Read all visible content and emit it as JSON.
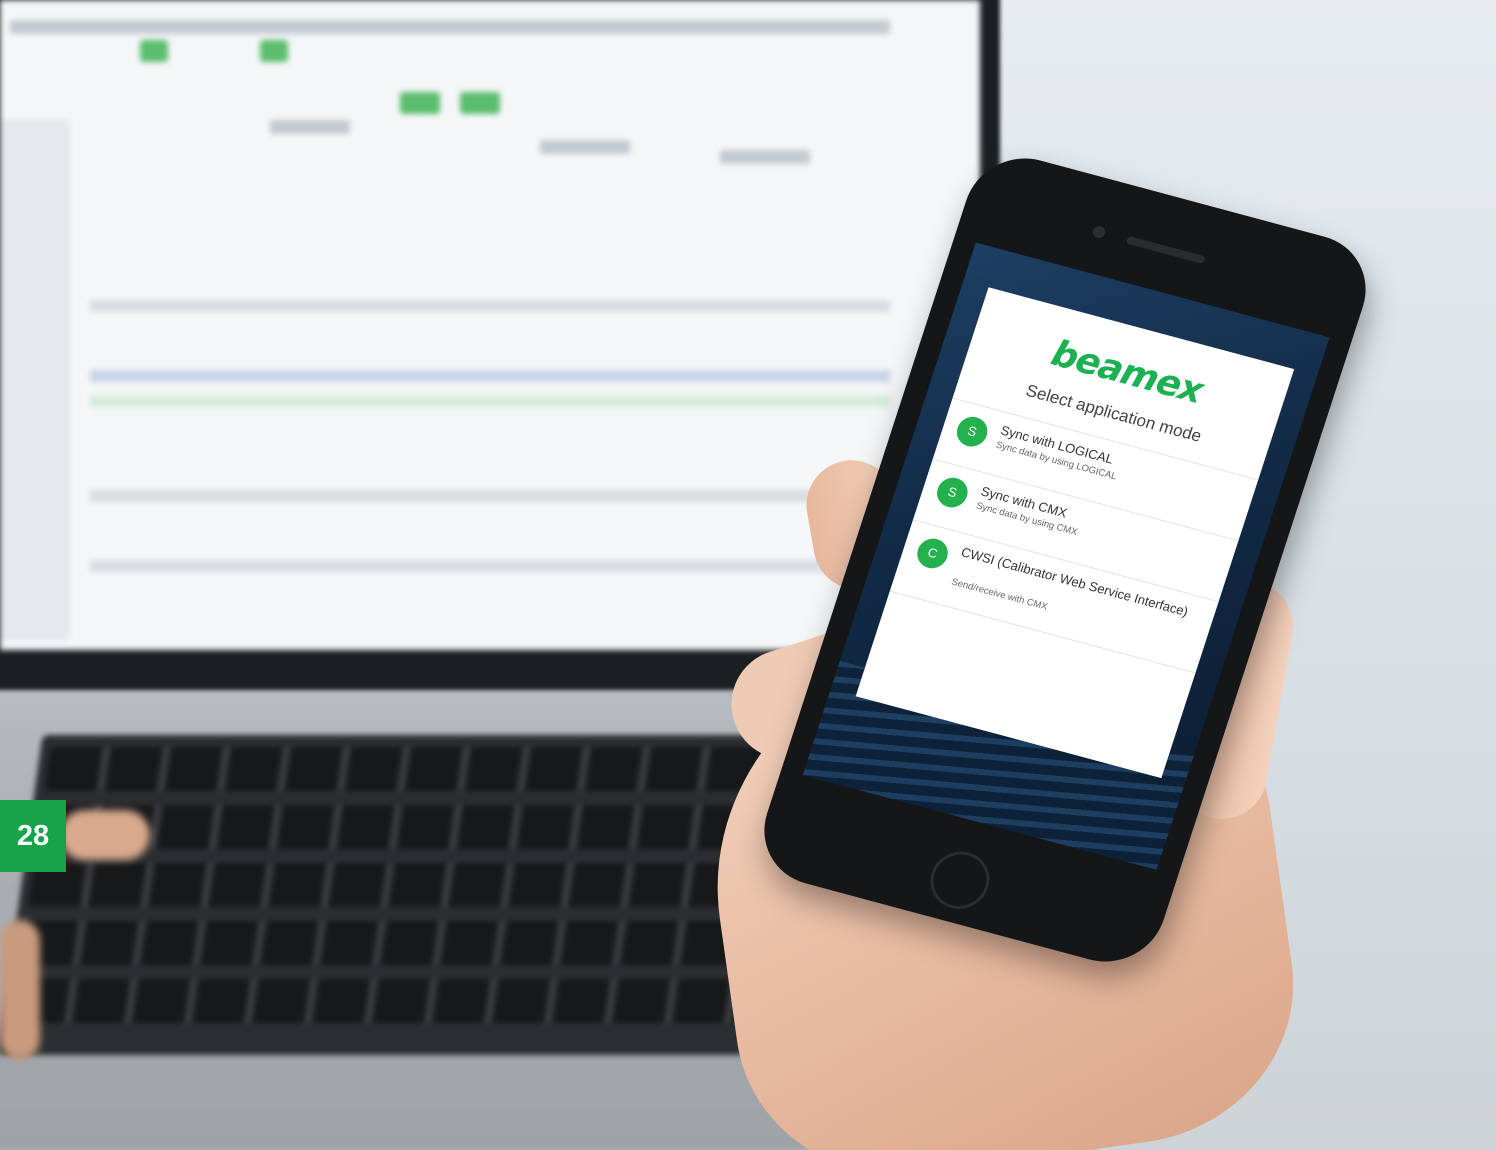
{
  "page_number": "28",
  "app": {
    "logo_text": "beamex",
    "heading": "Select application mode",
    "options": [
      {
        "badge": "S",
        "title": "Sync with LOGICAL",
        "subtitle": "Sync data by using LOGICAL"
      },
      {
        "badge": "S",
        "title": "Sync with CMX",
        "subtitle": "Sync data by using CMX"
      },
      {
        "badge": "C",
        "title": "CWSI (Calibrator Web Service Interface)",
        "subtitle": "Send/receive with CMX"
      }
    ]
  },
  "colors": {
    "brand_green": "#1bb152",
    "badge_green": "#22b14c",
    "page_badge": "#16a34a"
  }
}
